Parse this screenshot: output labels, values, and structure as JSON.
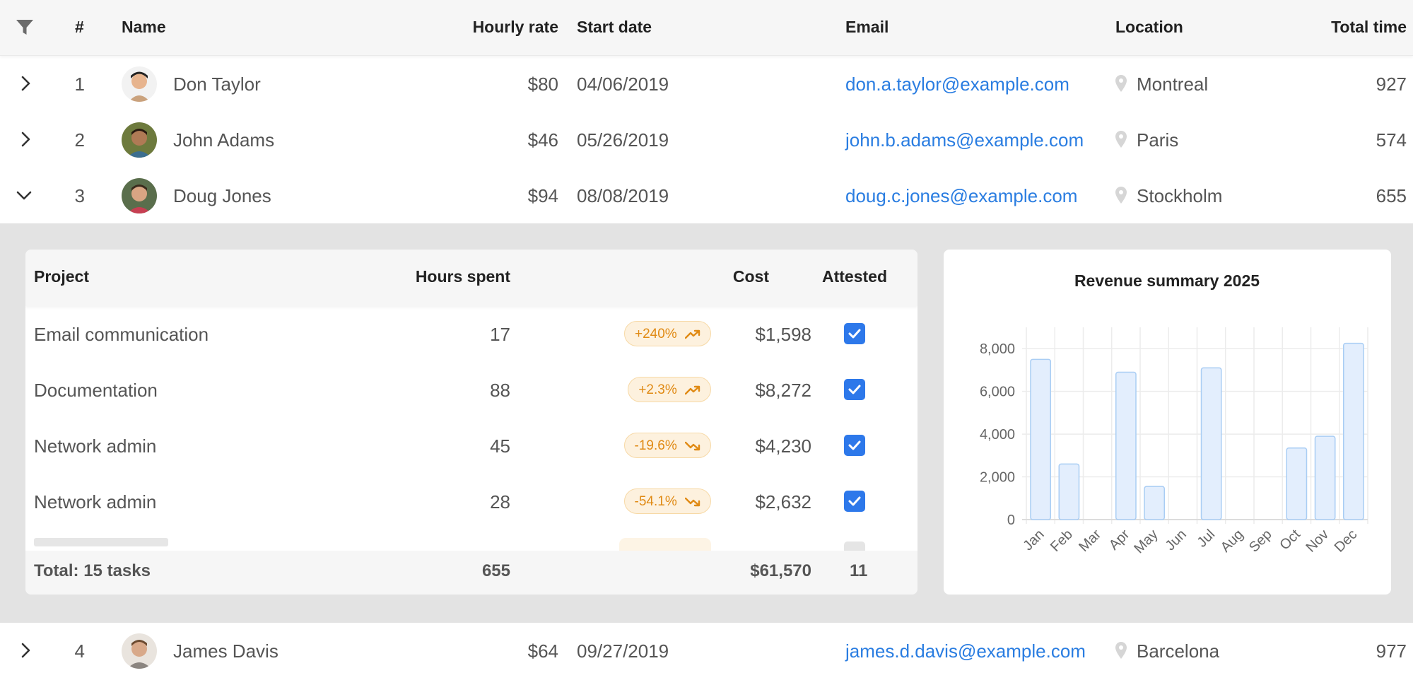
{
  "columns": {
    "number": "#",
    "name": "Name",
    "hourly_rate": "Hourly rate",
    "start_date": "Start date",
    "email": "Email",
    "location": "Location",
    "total_time": "Total time"
  },
  "rows": [
    {
      "num": "1",
      "name": "Don Taylor",
      "rate": "$80",
      "start": "04/06/2019",
      "email": "don.a.taylor@example.com",
      "location": "Montreal",
      "total": "927",
      "expanded": false
    },
    {
      "num": "2",
      "name": "John Adams",
      "rate": "$46",
      "start": "05/26/2019",
      "email": "john.b.adams@example.com",
      "location": "Paris",
      "total": "574",
      "expanded": false
    },
    {
      "num": "3",
      "name": "Doug Jones",
      "rate": "$94",
      "start": "08/08/2019",
      "email": "doug.c.jones@example.com",
      "location": "Stockholm",
      "total": "655",
      "expanded": true
    },
    {
      "num": "4",
      "name": "James Davis",
      "rate": "$64",
      "start": "09/27/2019",
      "email": "james.d.davis@example.com",
      "location": "Barcelona",
      "total": "977",
      "expanded": false
    }
  ],
  "detail": {
    "columns": {
      "project": "Project",
      "hours": "Hours spent",
      "cost": "Cost",
      "attested": "Attested"
    },
    "tasks": [
      {
        "project": "Email communication",
        "hours": "17",
        "change": "+240%",
        "trend": "up",
        "cost": "$1,598",
        "attested": true
      },
      {
        "project": "Documentation",
        "hours": "88",
        "change": "+2.3%",
        "trend": "up",
        "cost": "$8,272",
        "attested": true
      },
      {
        "project": "Network admin",
        "hours": "45",
        "change": "-19.6%",
        "trend": "down",
        "cost": "$4,230",
        "attested": true
      },
      {
        "project": "Network admin",
        "hours": "28",
        "change": "-54.1%",
        "trend": "down",
        "cost": "$2,632",
        "attested": true
      }
    ],
    "footer": {
      "total_label": "Total: 15 tasks",
      "hours": "655",
      "cost": "$61,570",
      "attested": "11"
    }
  },
  "colors": {
    "accent": "#2d78ea",
    "email": "#2a7de1",
    "badge_text": "#e08a14",
    "bar_fill": "#e3eefd",
    "bar_stroke": "#a9cdf4"
  },
  "chart_data": {
    "type": "bar",
    "title": "Revenue summary 2025",
    "categories": [
      "Jan",
      "Feb",
      "Mar",
      "Apr",
      "May",
      "Jun",
      "Jul",
      "Aug",
      "Sep",
      "Oct",
      "Nov",
      "Dec"
    ],
    "values": [
      7500,
      2600,
      0,
      6900,
      1550,
      0,
      7100,
      0,
      0,
      3350,
      3900,
      8250
    ],
    "ylim": [
      0,
      9000
    ],
    "yticks": [
      0,
      2000,
      4000,
      6000,
      8000
    ],
    "ytick_labels": [
      "0",
      "2,000",
      "4,000",
      "6,000",
      "8,000"
    ],
    "grid": true
  }
}
